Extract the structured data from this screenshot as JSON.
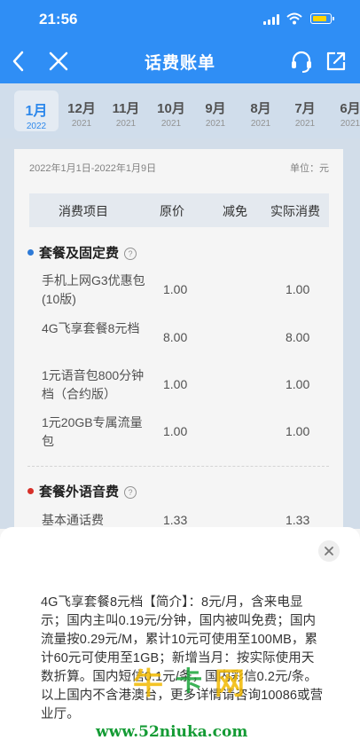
{
  "status_bar": {
    "time": "21:56"
  },
  "nav": {
    "title": "话费账单"
  },
  "months": [
    {
      "month": "1月",
      "year": "2022",
      "active": true
    },
    {
      "month": "12月",
      "year": "2021"
    },
    {
      "month": "11月",
      "year": "2021"
    },
    {
      "month": "10月",
      "year": "2021"
    },
    {
      "month": "9月",
      "year": "2021"
    },
    {
      "month": "8月",
      "year": "2021"
    },
    {
      "month": "7月",
      "year": "2021"
    },
    {
      "month": "6月",
      "year": "2021"
    }
  ],
  "bill": {
    "period": "2022年1月1日-2022年1月9日",
    "unit": "单位：元",
    "columns": {
      "item": "消费项目",
      "original": "原价",
      "discount": "减免",
      "actual": "实际消费"
    },
    "sections": [
      {
        "title": "套餐及固定费",
        "dot_color": "#2f7fe0",
        "items": [
          {
            "name": "手机上网G3优惠包(10版)",
            "original": "1.00",
            "actual": "1.00"
          },
          {
            "name": "4G飞享套餐8元档",
            "original": "8.00",
            "actual": "8.00"
          },
          {
            "name": "1元语音包800分钟档（合约版）",
            "original": "1.00",
            "actual": "1.00"
          },
          {
            "name": "1元20GB专属流量包",
            "original": "1.00",
            "actual": "1.00"
          }
        ]
      },
      {
        "title": "套餐外语音费",
        "dot_color": "#e0322b",
        "items": [
          {
            "name": "基本通话费",
            "original": "1.33",
            "actual": "1.33"
          }
        ]
      }
    ]
  },
  "sheet": {
    "description": "4G飞享套餐8元档【简介】：8元/月，含来电显示；国内主叫0.19元/分钟，国内被叫免费；国内流量按0.29元/M，累计10元可使用至100MB，累计60元可使用至1GB；新增当月：按实际使用天数折算。国内短信0.1元/条，国内彩信0.2元/条。以上国内不含港澳台，更多详情请咨询10086或营业厅。"
  },
  "watermark": {
    "url": "www.52niuka.com",
    "logo_text": "牛卡网"
  }
}
